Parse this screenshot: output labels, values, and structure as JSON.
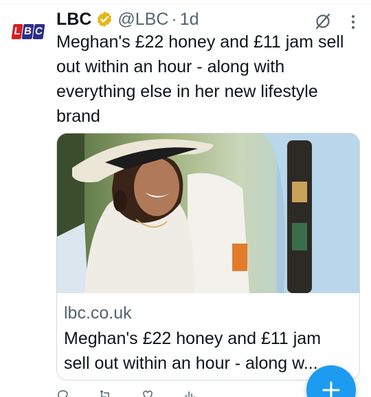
{
  "tweet": {
    "author_name": "LBC",
    "handle": "@LBC",
    "separator": "·",
    "time": "1d",
    "avatar_text": {
      "l": "L",
      "b": "B",
      "c": "C"
    },
    "text": "Meghan's £22 honey and £11 jam sell out within an hour - along with everything else in her new lifestyle brand"
  },
  "card": {
    "domain": "lbc.co.uk",
    "title": "Meghan's £22 honey and £11 jam sell out within an hour - along w..."
  },
  "actions": {
    "replies": "",
    "reposts": "",
    "likes": "",
    "views": ""
  },
  "icons": {
    "verified": "verified-badge-icon",
    "grok": "grok-icon",
    "more": "more-icon",
    "compose": "plus-icon"
  },
  "colors": {
    "accent": "#1d9bf0",
    "verified_gold": "#e2b719",
    "text_primary": "#0f1419",
    "text_secondary": "#536471",
    "lbc_red": "#d61f26",
    "lbc_blue": "#2b2f8a"
  }
}
